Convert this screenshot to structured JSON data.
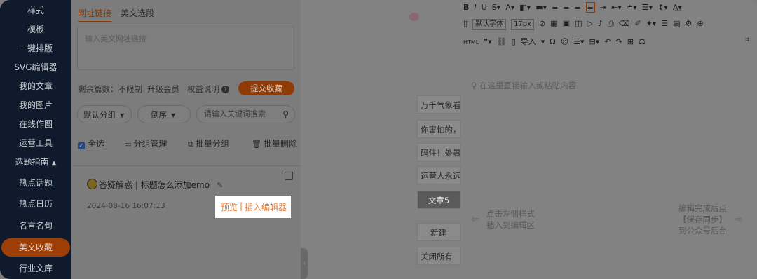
{
  "sidebar": {
    "items": [
      {
        "label": "样式"
      },
      {
        "label": "模板"
      },
      {
        "label": "一键排版"
      },
      {
        "label": "SVG编辑器"
      },
      {
        "label": "我的文章"
      },
      {
        "label": "我的图片"
      },
      {
        "label": "在线作图"
      },
      {
        "label": "运营工具"
      },
      {
        "label": "选题指南",
        "caret": "▲"
      },
      {
        "label": "热点话题"
      },
      {
        "label": "热点日历"
      },
      {
        "label": "名言名句"
      },
      {
        "label": "美文收藏",
        "active": true
      },
      {
        "label": "行业文库"
      }
    ]
  },
  "panel": {
    "tabs": [
      "网址链接",
      "美文选段"
    ],
    "url_placeholder": "输入美文网址链接",
    "quota_prefix": "剩余篇数：不限制",
    "upgrade": "升级会员",
    "rights": "权益说明",
    "help_icon": "?",
    "submit": "提交收藏",
    "group_select": "默认分组",
    "order_select": "倒序",
    "search_placeholder": "请输入关键词搜索",
    "select_all": "全选",
    "group_manage": "分组管理",
    "batch_group": "批量分组",
    "batch_delete": "批量删除",
    "card": {
      "title": "答疑解惑 | 标题怎么添加emo",
      "date": "2024-08-16 16:07:13",
      "preview": "预览",
      "separator": "|",
      "insert": "插入编辑器"
    }
  },
  "middle": {
    "items": [
      "万千气象看",
      "你害怕的，",
      "码住！处暑",
      "运营人永远"
    ],
    "article_btn": "文章5",
    "new_btn": "新建",
    "close_all": "关闭所有"
  },
  "editor": {
    "font_family": "默认字体",
    "font_size": "17px",
    "placeholder": "在这里直接输入或粘贴内容",
    "hint_left_1": "点击左侧样式",
    "hint_left_2": "插入到编辑区",
    "hint_right_1": "编辑完成后点",
    "hint_right_2": "【保存同步】",
    "hint_right_3": "到公众号后台",
    "html_label": "HTML",
    "import_label": "导入"
  }
}
